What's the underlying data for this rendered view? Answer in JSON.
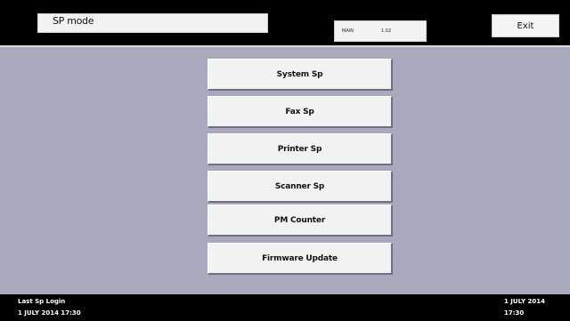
{
  "header": {
    "mode_title": "SP mode",
    "version_label": "MAIN",
    "version_value": "1.02",
    "exit_label": "Exit"
  },
  "menu": {
    "items": [
      {
        "label": "System Sp"
      },
      {
        "label": "Fax Sp"
      },
      {
        "label": "Printer Sp"
      },
      {
        "label": "Scanner Sp"
      },
      {
        "label": "PM Counter"
      },
      {
        "label": "Firmware Update"
      }
    ]
  },
  "footer": {
    "last_login_label": "Last Sp Login",
    "last_login_datetime": "1 JULY 2014 17:30",
    "current_date": "1 JULY 2014",
    "current_time": "17:30"
  },
  "colors": {
    "background": "#a9a9bd",
    "bars": "#000000",
    "button_face": "#f2f2f2"
  }
}
